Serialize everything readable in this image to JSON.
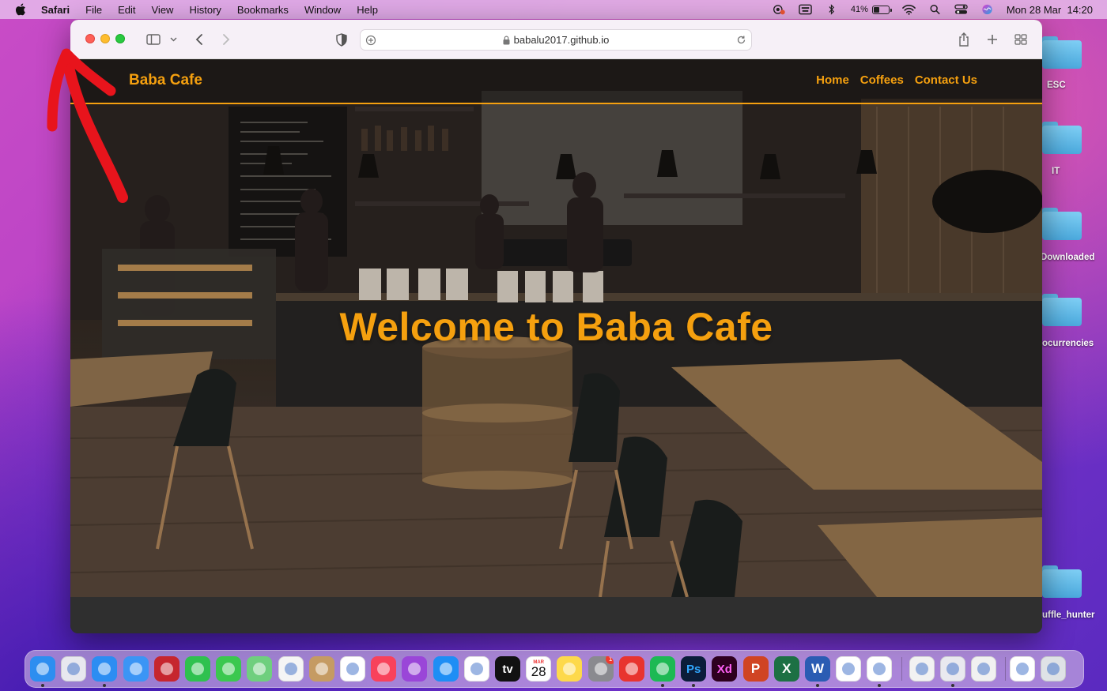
{
  "menubar": {
    "app": "Safari",
    "items": [
      "File",
      "Edit",
      "View",
      "History",
      "Bookmarks",
      "Window",
      "Help"
    ],
    "battery_percent": "41%",
    "battery_level": 0.41,
    "datetime": "Mon 28 Mar  14:20",
    "status_icons": [
      "screen-time-icon",
      "keyboard-icon",
      "bluetooth-icon",
      "battery-icon",
      "wifi-icon",
      "search-icon",
      "control-center-icon",
      "siri-icon"
    ]
  },
  "browser": {
    "url": "babalu2017.github.io",
    "toolbar_icons": [
      "sidebar-icon",
      "chevron-down-icon",
      "back-icon",
      "forward-icon",
      "privacy-shield-icon",
      "share-icon",
      "new-tab-icon",
      "tab-overview-icon"
    ]
  },
  "site": {
    "logo": "Baba Cafe",
    "nav": [
      "Home",
      "Coffees",
      "Contact Us"
    ],
    "hero_title": "Welcome to Baba Cafe",
    "accent_color": "#f5a00f"
  },
  "desktop": {
    "folders": [
      "ESC",
      "IT",
      "Downloaded",
      "ocurrencies",
      "uffle_hunter"
    ]
  },
  "dock": {
    "apps": [
      {
        "name": "finder",
        "icon": "finder-icon",
        "color": "#2d8ef0"
      },
      {
        "name": "launchpad",
        "icon": "launchpad-icon",
        "color": "#e8e8ef"
      },
      {
        "name": "safari",
        "icon": "safari-icon",
        "color": "#2c8df2"
      },
      {
        "name": "mail",
        "icon": "mail-icon",
        "color": "#3b95f5"
      },
      {
        "name": "photo-booth",
        "icon": "photo-booth-icon",
        "color": "#c6262e"
      },
      {
        "name": "facetime",
        "icon": "facetime-icon",
        "color": "#2fc14f"
      },
      {
        "name": "messages",
        "icon": "messages-icon",
        "color": "#3bc84f"
      },
      {
        "name": "maps",
        "icon": "maps-icon",
        "color": "#6fcf7e"
      },
      {
        "name": "photos",
        "icon": "photos-icon",
        "color": "#f5f5f5"
      },
      {
        "name": "contacts",
        "icon": "contacts-icon",
        "color": "#c59b63"
      },
      {
        "name": "reminders",
        "icon": "reminders-icon",
        "color": "#ffffff"
      },
      {
        "name": "music",
        "icon": "music-icon",
        "color": "#f8425b"
      },
      {
        "name": "podcasts",
        "icon": "podcasts-icon",
        "color": "#9a46d8"
      },
      {
        "name": "app-store",
        "icon": "app-store-icon",
        "color": "#1e8ef5"
      },
      {
        "name": "news",
        "icon": "news-icon",
        "color": "#ffffff"
      },
      {
        "name": "apple-tv",
        "icon": "apple-tv-icon",
        "color": "#111111",
        "text": "tv"
      },
      {
        "name": "calendar",
        "icon": "calendar-icon",
        "color": "#ffffff",
        "text": "28",
        "month": "MAR"
      },
      {
        "name": "notes",
        "icon": "notes-icon",
        "color": "#fdd94b"
      },
      {
        "name": "system-preferences",
        "icon": "system-preferences-icon",
        "color": "#8a8a8f",
        "badge": "1"
      },
      {
        "name": "creative-cloud",
        "icon": "creative-cloud-icon",
        "color": "#e8342f"
      },
      {
        "name": "spotify",
        "icon": "spotify-icon",
        "color": "#1db954"
      },
      {
        "name": "photoshop",
        "icon": "photoshop-icon",
        "color": "#0b1d3a",
        "text": "Ps",
        "textcolor": "#31a8ff"
      },
      {
        "name": "adobe-xd",
        "icon": "adobe-xd-icon",
        "color": "#2e001f",
        "text": "Xd",
        "textcolor": "#ff61f6"
      },
      {
        "name": "powerpoint",
        "icon": "powerpoint-icon",
        "color": "#d04423",
        "text": "P"
      },
      {
        "name": "excel",
        "icon": "excel-icon",
        "color": "#1d7044",
        "text": "X"
      },
      {
        "name": "word",
        "icon": "word-icon",
        "color": "#2b5cb3",
        "text": "W"
      },
      {
        "name": "vscode",
        "icon": "vscode-icon",
        "color": "#ffffff"
      },
      {
        "name": "chrome",
        "icon": "chrome-icon",
        "color": "#ffffff"
      },
      {
        "name": "textedit",
        "icon": "textedit-icon",
        "color": "#f2f2f2"
      },
      {
        "name": "preview",
        "icon": "preview-icon",
        "color": "#e9e9ef"
      },
      {
        "name": "memoji",
        "icon": "memoji-icon",
        "color": "#f1f1f1"
      },
      {
        "name": "downloads-stack",
        "icon": "document-stack-icon",
        "color": "#ffffff"
      },
      {
        "name": "trash",
        "icon": "trash-icon",
        "color": "#dfe2e6"
      }
    ]
  }
}
